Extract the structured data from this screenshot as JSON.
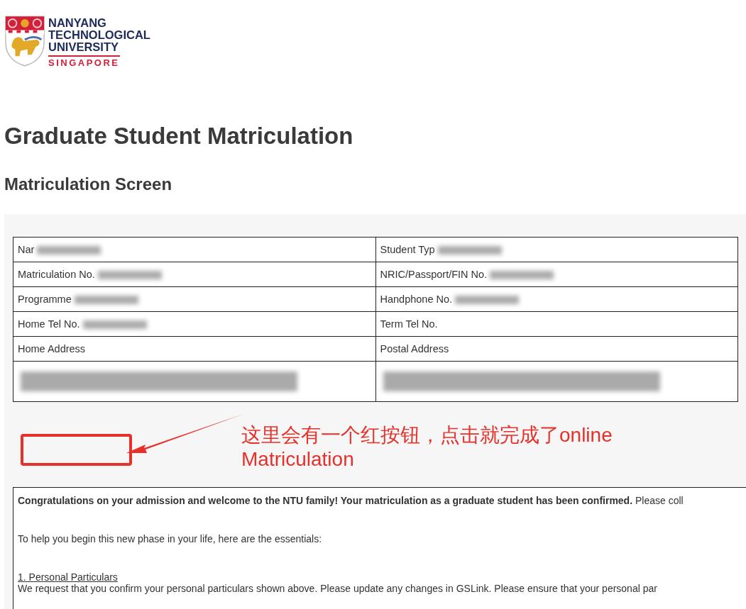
{
  "logo": {
    "lines": [
      "NANYANG",
      "TECHNOLOGICAL",
      "UNIVERSITY"
    ],
    "country": "SINGAPORE"
  },
  "title": "Graduate Student Matriculation",
  "subtitle": "Matriculation Screen",
  "table": {
    "rows": [
      [
        {
          "label": "Nar",
          "redacted": true
        },
        {
          "label": "Student Typ",
          "redacted": true
        }
      ],
      [
        {
          "label": "Matriculation No.",
          "redacted": true
        },
        {
          "label": "NRIC/Passport/FIN No.",
          "redacted": true
        }
      ],
      [
        {
          "label": "Programme",
          "redacted": true
        },
        {
          "label": "Handphone No.",
          "redacted": true
        }
      ],
      [
        {
          "label": "Home Tel No.",
          "redacted": true
        },
        {
          "label": "Term Tel No.",
          "redacted": false
        }
      ],
      [
        {
          "label": "Home Address",
          "redacted": false
        },
        {
          "label": "Postal Address",
          "redacted": false
        }
      ],
      [
        {
          "redacted": true
        },
        {
          "redacted": true
        }
      ]
    ]
  },
  "annotation": {
    "text": "这里会有一个红按钮，点击就完成了online Matriculation",
    "color": "#e8302a"
  },
  "message": {
    "paragraphs": [
      {
        "kind": "text",
        "text": "**Congratulations on your admission and welcome to the NTU family! Your matriculation as a graduate student has been confirmed.** Please coll"
      },
      {
        "kind": "text",
        "text": "To help you begin this new phase in your life, here are the essentials:"
      },
      {
        "kind": "heading",
        "text": "1. Personal Particulars"
      },
      {
        "kind": "line",
        "text": "We request that you confirm your personal particulars shown above. Please update any changes in GSLink. Please ensure that your personal par"
      }
    ]
  }
}
